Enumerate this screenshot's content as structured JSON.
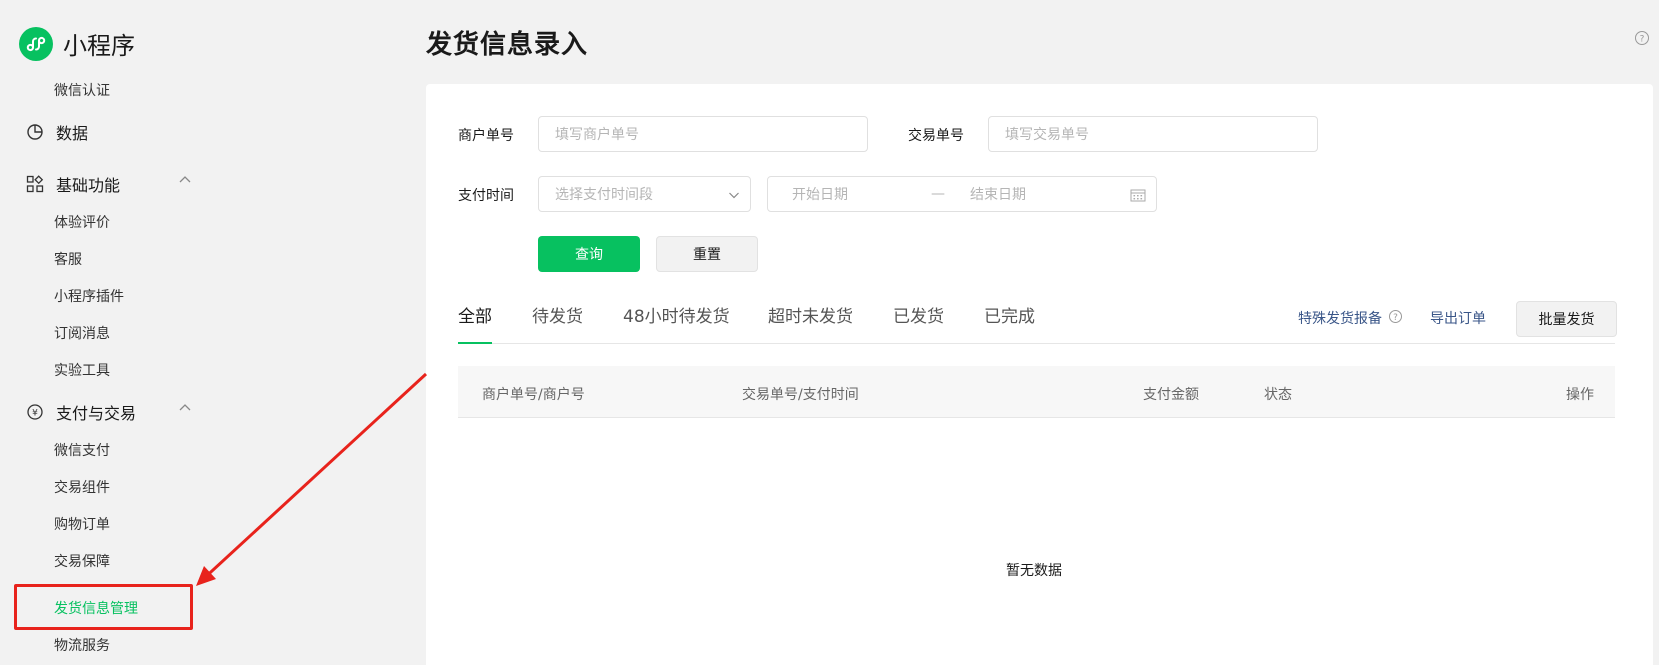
{
  "app": {
    "logo_text": "小程序"
  },
  "sidebar": {
    "top_item": "微信认证",
    "data_item": "数据",
    "group_basic": {
      "label": "基础功能",
      "items": [
        "体验评价",
        "客服",
        "小程序插件",
        "订阅消息",
        "实验工具"
      ]
    },
    "group_pay": {
      "label": "支付与交易",
      "items": [
        "微信支付",
        "交易组件",
        "购物订单",
        "交易保障",
        "发货信息管理",
        "物流服务"
      ]
    },
    "active_item": "发货信息管理"
  },
  "page": {
    "title": "发货信息录入"
  },
  "filters": {
    "merchant_label": "商户单号",
    "merchant_placeholder": "填写商户单号",
    "trade_label": "交易单号",
    "trade_placeholder": "填写交易单号",
    "paytime_label": "支付时间",
    "paytime_select": "选择支付时间段",
    "start_date": "开始日期",
    "date_sep": "—",
    "end_date": "结束日期",
    "query_button": "查询",
    "reset_button": "重置"
  },
  "tabs": [
    "全部",
    "待发货",
    "48小时待发货",
    "超时未发货",
    "已发货",
    "已完成"
  ],
  "actions": {
    "special_report": "特殊发货报备",
    "export_orders": "导出订单",
    "batch_ship": "批量发货"
  },
  "table": {
    "columns": [
      "商户单号/商户号",
      "交易单号/支付时间",
      "支付金额",
      "状态",
      "操作"
    ],
    "empty_text": "暂无数据"
  },
  "colors": {
    "brand": "#07c160",
    "annotation": "#e8231c",
    "link": "#3a5688"
  }
}
